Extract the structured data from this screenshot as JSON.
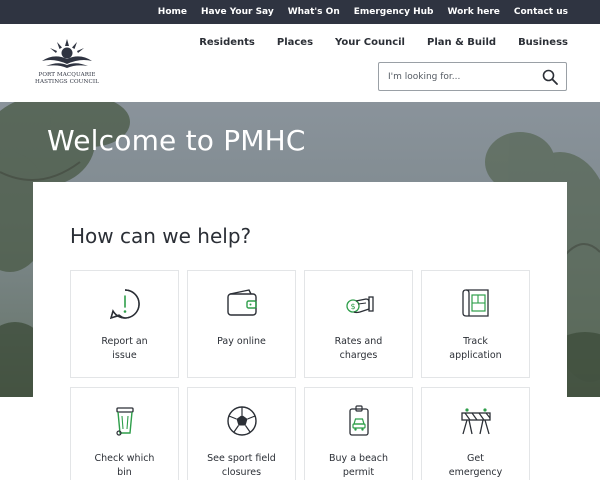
{
  "topbar": {
    "links": [
      "Home",
      "Have Your Say",
      "What's On",
      "Emergency Hub",
      "Work here",
      "Contact us"
    ]
  },
  "logo": {
    "line1": "PORT MACQUARIE",
    "line2": "HASTINGS COUNCIL"
  },
  "mainnav": {
    "items": [
      "Residents",
      "Places",
      "Your Council",
      "Plan & Build",
      "Business"
    ]
  },
  "search": {
    "placeholder": "I'm looking for..."
  },
  "hero": {
    "title": "Welcome to PMHC"
  },
  "help": {
    "title": "How can we help?",
    "tiles": [
      {
        "line1": "Report an",
        "line2": "issue",
        "icon": "report-issue-icon"
      },
      {
        "line1": "Pay online",
        "line2": "",
        "icon": "wallet-icon"
      },
      {
        "line1": "Rates and",
        "line2": "charges",
        "icon": "rates-hand-icon"
      },
      {
        "line1": "Track",
        "line2": "application",
        "icon": "blueprint-icon"
      },
      {
        "line1": "Check which",
        "line2": "bin",
        "icon": "bin-icon"
      },
      {
        "line1": "See sport field",
        "line2": "closures",
        "icon": "soccer-ball-icon"
      },
      {
        "line1": "Buy a beach",
        "line2": "permit",
        "icon": "beach-permit-icon"
      },
      {
        "line1": "Get",
        "line2": "emergency",
        "icon": "road-barrier-icon"
      }
    ]
  },
  "colors": {
    "topbar": "#2f3441",
    "icon_green": "#2e9e4a",
    "text_dark": "#2b2f36"
  }
}
